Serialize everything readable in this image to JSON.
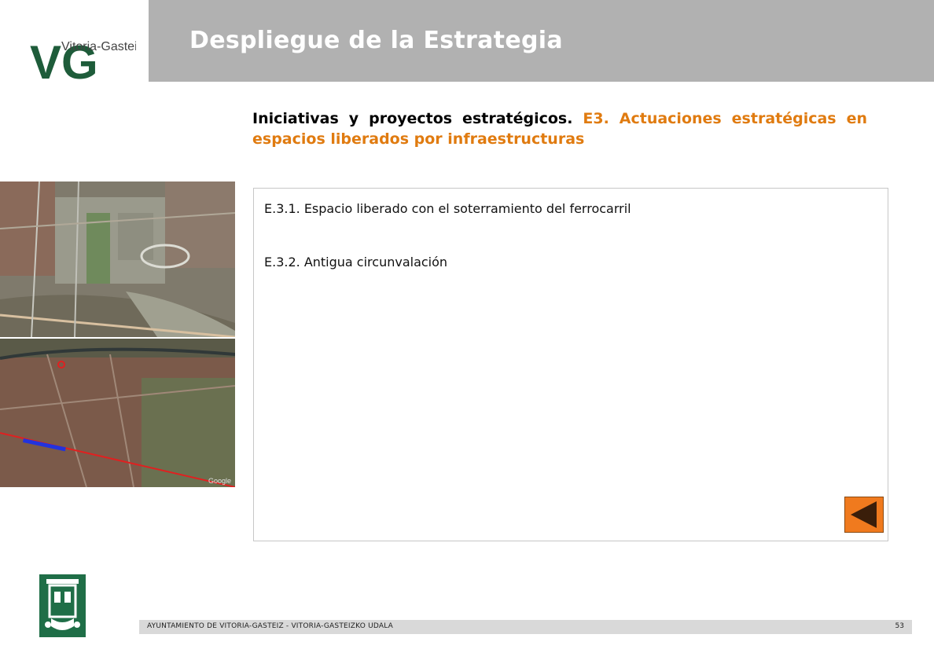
{
  "header": {
    "logo_text": "Vitoria-Gasteiz",
    "logo_monogram": "VG",
    "title": "Despliegue de la Estrategia"
  },
  "subtitle": {
    "lead": "Iniciativas y proyectos estratégicos.",
    "highlight": "E3. Actuaciones estratégicas en espacios liberados por infraestructuras"
  },
  "items": [
    {
      "label": "E.3.1. Espacio liberado con el soterramiento del ferrocarril"
    },
    {
      "label": "E.3.2. Antigua circunvalación"
    }
  ],
  "photos": {
    "bottom_watermark": "Google"
  },
  "back_button": {
    "icon": "left-triangle-icon"
  },
  "footer": {
    "text": "AYUNTAMIENTO DE VITORIA-GASTEIZ - VITORIA-GASTEIZKO UDALA",
    "page": "53"
  },
  "colors": {
    "header_gray": "#b1b1b1",
    "accent_orange": "#e07b10",
    "button_orange": "#f07a1e",
    "crest_green": "#1f6e47",
    "logo_green": "#1e5c3a"
  }
}
